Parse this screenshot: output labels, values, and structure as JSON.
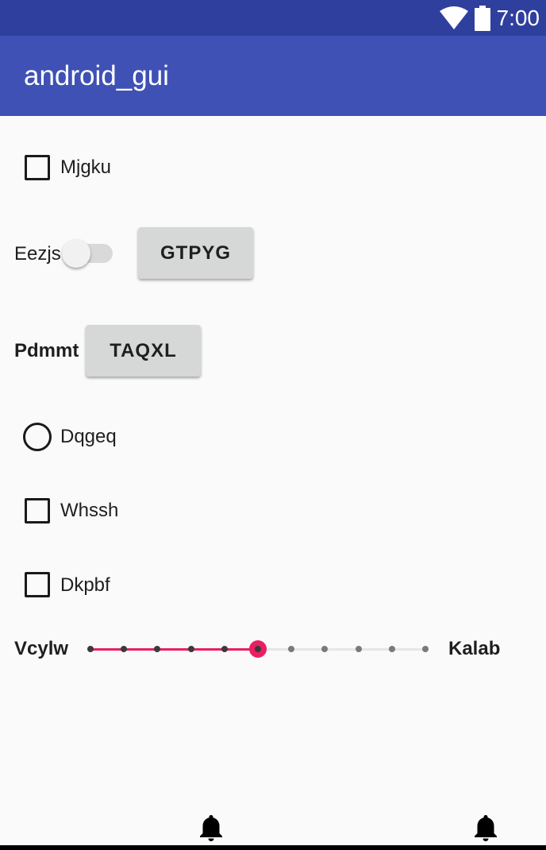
{
  "status_bar": {
    "time": "7:00",
    "icons": [
      "wifi-icon",
      "battery-icon"
    ],
    "color": "#2f3f9e"
  },
  "app_bar": {
    "title": "android_gui",
    "color": "#3f51b5"
  },
  "widgets": {
    "checkbox_1": {
      "label": "Mjgku",
      "checked": false
    },
    "switch_row": {
      "label": "Eezjs",
      "on": false,
      "button_label": "GTPYG"
    },
    "button_row": {
      "label": "Pdmmt",
      "button_label": "TAQXL"
    },
    "radio_1": {
      "label": "Dqgeq",
      "selected": false
    },
    "checkbox_2": {
      "label": "Whssh",
      "checked": false
    },
    "checkbox_3": {
      "label": "Dkpbf",
      "checked": false
    },
    "seekbar": {
      "left_label": "Vcylw",
      "right_label": "Kalab",
      "value": 5,
      "max": 10,
      "accent": "#e91e63"
    }
  },
  "bottom_bar": {
    "icons": [
      "bell-icon",
      "bell-icon"
    ]
  }
}
